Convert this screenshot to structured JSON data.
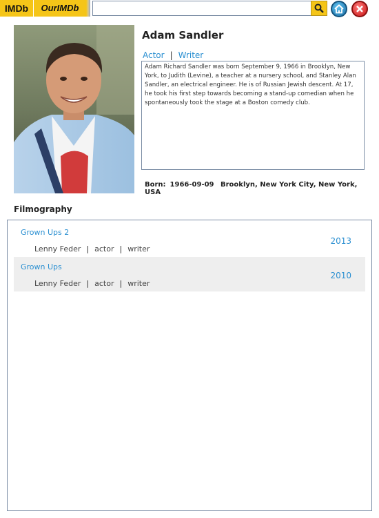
{
  "header": {
    "logo_primary": "IMDb",
    "logo_secondary": "OurIMDb",
    "search": {
      "value": "",
      "placeholder": ""
    },
    "search_icon": "search-icon",
    "home_icon": "home-icon",
    "close_icon": "close-icon",
    "accent_color": "#f5c518"
  },
  "person": {
    "name": "Adam Sandler",
    "roles": [
      "Actor",
      "Writer"
    ],
    "bio": "Adam Richard Sandler was born September 9, 1966 in Brooklyn, New York, to Judith (Levine), a teacher at a nursery school, and Stanley Alan Sandler, an electrical engineer. He is of Russian Jewish descent. At 17, he took his first step towards becoming a stand-up comedian when he spontaneously took the stage at a Boston comedy club.",
    "born_label": "Born:",
    "born_date": "1966-09-09",
    "born_place": "Brooklyn, New York City, New York, USA"
  },
  "filmography": {
    "title": "Filmography",
    "items": [
      {
        "title": "Grown Ups 2",
        "character": "Lenny Feder",
        "roles": [
          "actor",
          "writer"
        ],
        "year": "2013"
      },
      {
        "title": "Grown Ups",
        "character": "Lenny Feder",
        "roles": [
          "actor",
          "writer"
        ],
        "year": "2010"
      }
    ]
  },
  "colors": {
    "link": "#2a8fd1",
    "row_alt": "#eeeeee",
    "border": "#7a8ca4"
  }
}
